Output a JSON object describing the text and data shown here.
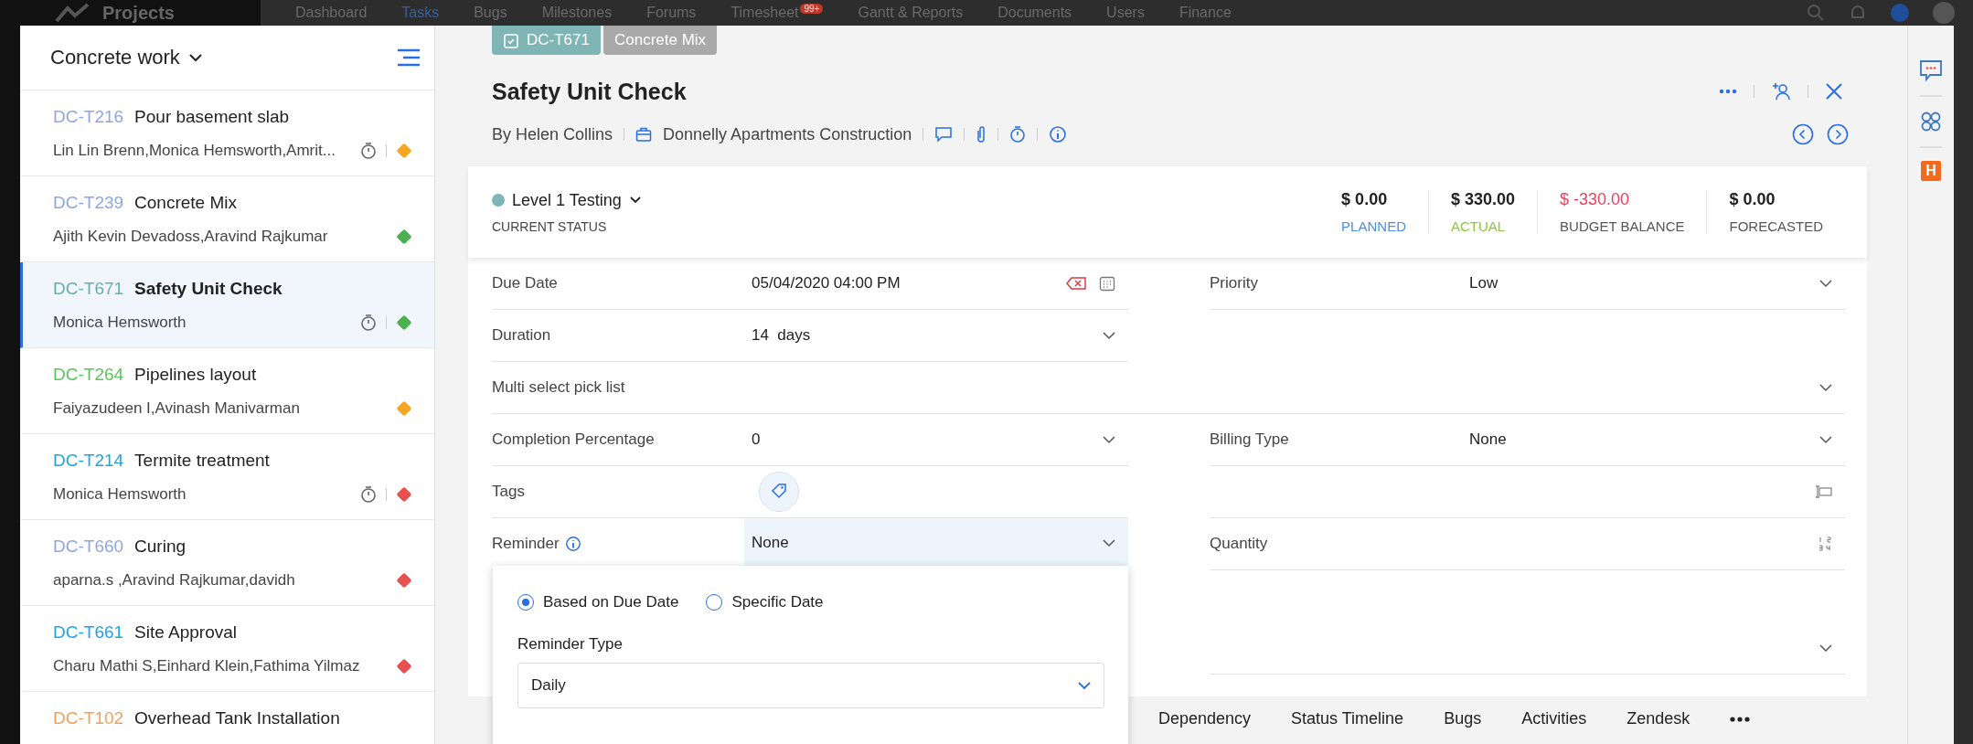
{
  "top_nav": {
    "app_title": "Projects",
    "items": [
      {
        "label": "Dashboard",
        "selected": false
      },
      {
        "label": "Tasks",
        "selected": true
      },
      {
        "label": "Bugs",
        "selected": false
      },
      {
        "label": "Milestones",
        "selected": false
      },
      {
        "label": "Forums",
        "selected": false
      },
      {
        "label": "Timesheet",
        "selected": false,
        "badge": "99+"
      },
      {
        "label": "Gantt & Reports",
        "selected": false
      },
      {
        "label": "Documents",
        "selected": false
      },
      {
        "label": "Users",
        "selected": false
      },
      {
        "label": "Finance",
        "selected": false
      }
    ]
  },
  "task_list": {
    "title": "Concrete work",
    "tasks": [
      {
        "id": "DC-T216",
        "color": "#8fa6e0",
        "name": "Pour basement slab",
        "owners": "Lin Lin Brenn,Monica Hemsworth,Amrit...",
        "timer": true,
        "priority": {
          "color": "#f5a623"
        },
        "selected": false
      },
      {
        "id": "DC-T239",
        "color": "#8fa6e0",
        "name": "Concrete Mix",
        "owners": "Ajith Kevin Devadoss,Aravind Rajkumar",
        "timer": false,
        "priority": {
          "color": "#4caf50"
        },
        "selected": false
      },
      {
        "id": "DC-T671",
        "color": "#6aaeae",
        "name": "Safety Unit Check",
        "owners": "Monica Hemsworth",
        "timer": true,
        "priority": {
          "color": "#4caf50"
        },
        "selected": true
      },
      {
        "id": "DC-T264",
        "color": "#5cc45c",
        "name": "Pipelines layout",
        "owners": "Faiyazudeen I,Avinash Manivarman",
        "timer": false,
        "priority": {
          "color": "#f5a623"
        },
        "selected": false
      },
      {
        "id": "DC-T214",
        "color": "#1ea5e0",
        "name": "Termite treatment",
        "owners": "Monica Hemsworth",
        "timer": true,
        "priority": {
          "color": "#e84f4f"
        },
        "selected": false
      },
      {
        "id": "DC-T660",
        "color": "#8fa6e0",
        "name": "Curing",
        "owners": "aparna.s ,Aravind Rajkumar,davidh",
        "timer": false,
        "priority": {
          "color": "#e84f4f"
        },
        "selected": false
      },
      {
        "id": "DC-T661",
        "color": "#1ea5e0",
        "name": "Site Approval",
        "owners": "Charu Mathi S,Einhard Klein,Fathima Yilmaz",
        "timer": false,
        "priority": {
          "color": "#e84f4f"
        },
        "selected": false
      },
      {
        "id": "DC-T102",
        "color": "#f0a060",
        "name": "Overhead Tank Installation",
        "selected": false
      }
    ]
  },
  "task": {
    "chips": [
      {
        "label": "DC-T671",
        "kind": "id"
      },
      {
        "label": "Concrete Mix",
        "kind": "parent"
      }
    ],
    "title": "Safety Unit Check",
    "author": "By Helen Collins",
    "project": "Donnelly Apartments Construction",
    "status": {
      "label": "Level 1 Testing",
      "caption": "CURRENT STATUS",
      "color": "#7fb5b5"
    },
    "budget": [
      {
        "value": "$ 0.00",
        "label": "PLANNED",
        "color": "#4a8fe0",
        "negative": false
      },
      {
        "value": "$ 330.00",
        "label": "ACTUAL",
        "color": "#8cc63f",
        "negative": false
      },
      {
        "value": "$ -330.00",
        "label": "BUDGET BALANCE",
        "color": "#555555",
        "negative": true
      },
      {
        "value": "$ 0.00",
        "label": "FORECASTED",
        "color": "#555555",
        "negative": false
      }
    ],
    "fields": [
      {
        "left": {
          "label": "Due Date",
          "value": "05/04/2020 04:00 PM",
          "kind": "date"
        },
        "right": {
          "label": "Priority",
          "value": "Low",
          "kind": "select"
        }
      },
      {
        "left": {
          "label": "Duration",
          "value": "14  days",
          "kind": "select"
        }
      },
      {
        "full": {
          "label": "Multi select pick list",
          "kind": "select"
        }
      },
      {
        "left": {
          "label": "Completion Percentage",
          "value": "0",
          "kind": "select"
        },
        "right": {
          "label": "Billing Type",
          "value": "None",
          "kind": "select"
        }
      },
      {
        "left": {
          "label": "Tags",
          "kind": "tags"
        },
        "right": {
          "kind": "text"
        }
      },
      {
        "left": {
          "label": "Reminder",
          "value": "None",
          "kind": "select",
          "info": true,
          "focused": true
        },
        "right": {
          "label": "Quantity",
          "kind": "number"
        }
      },
      {
        "right": {
          "kind": "select"
        }
      }
    ],
    "reminder_popup": {
      "options": [
        {
          "label": "Based on Due Date",
          "selected": true
        },
        {
          "label": "Specific Date",
          "selected": false
        }
      ],
      "type_label": "Reminder Type",
      "type_value": "Daily"
    },
    "tabs": [
      "Dependency",
      "Status Timeline",
      "Bugs",
      "Activities",
      "Zendesk"
    ]
  },
  "side_rail": {
    "badge": "H"
  }
}
